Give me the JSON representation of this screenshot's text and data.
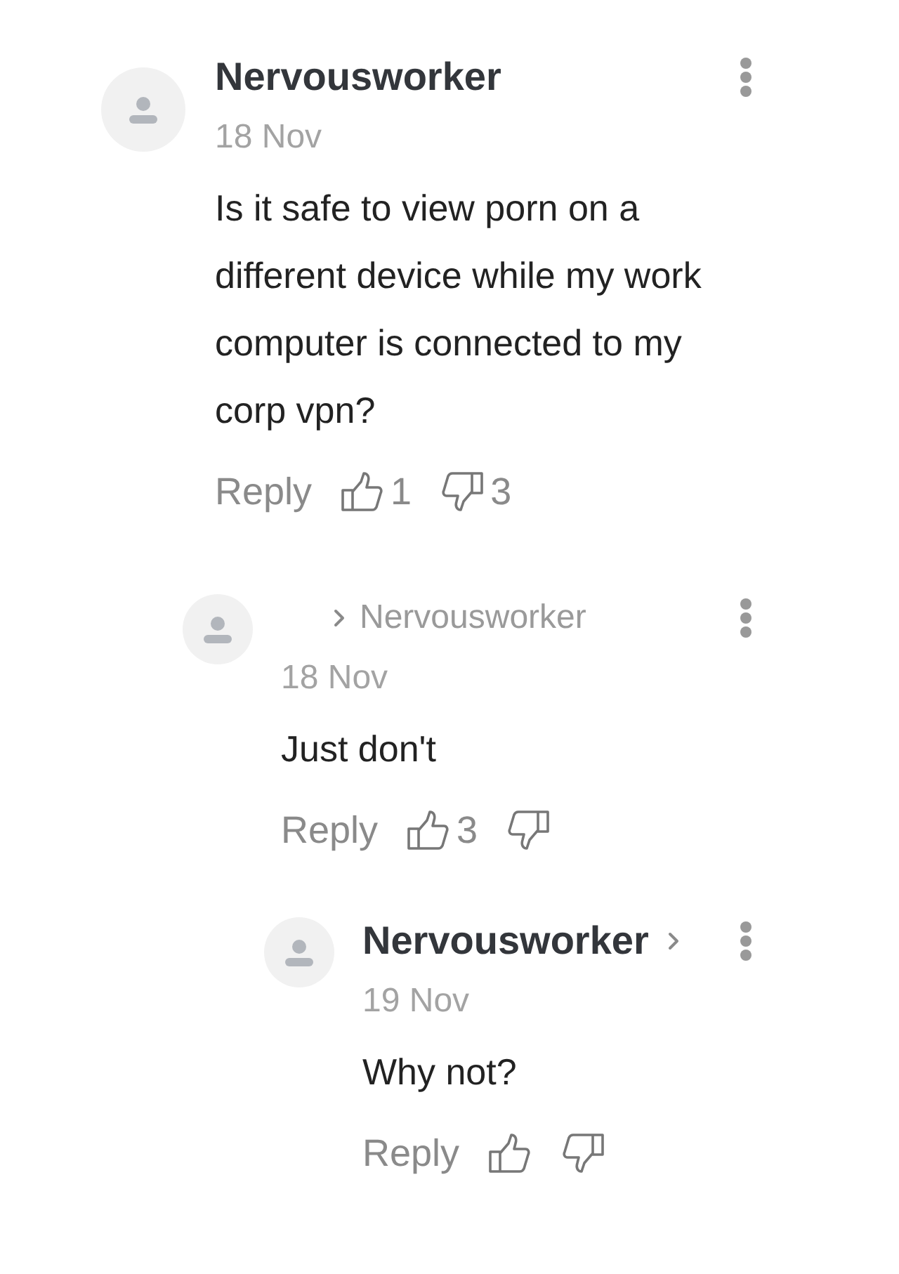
{
  "comments": [
    {
      "kind": "name",
      "author": "Nervousworker",
      "date": "18 Nov",
      "text": "Is it safe to view porn on a different device while my work computer is connected to my corp vpn?",
      "reply_label": "Reply",
      "likes": "1",
      "dislikes": "3",
      "children": [
        {
          "kind": "reply_to",
          "reply_to": "Nervousworker",
          "date": "18 Nov",
          "text": "Just don't",
          "reply_label": "Reply",
          "likes": "3",
          "children": [
            {
              "kind": "name_chevron",
              "author": "Nervousworker",
              "date": "19 Nov",
              "text": "Why not?",
              "reply_label": "Reply"
            }
          ]
        }
      ]
    }
  ]
}
